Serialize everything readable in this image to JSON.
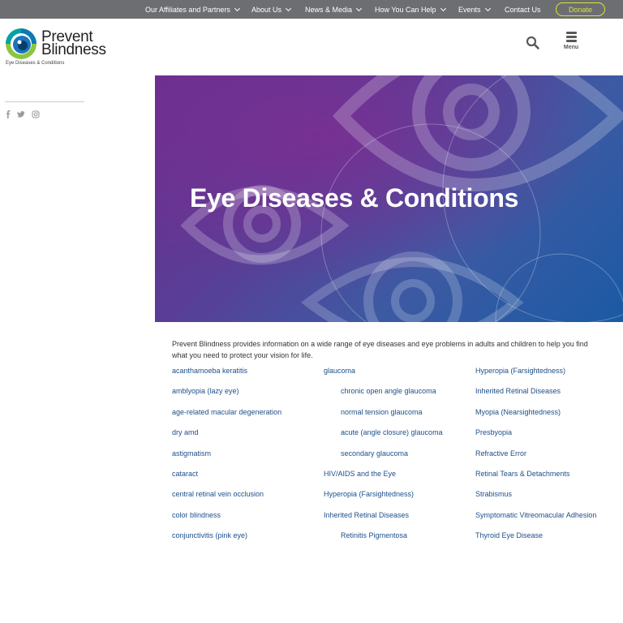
{
  "topnav": {
    "items": [
      {
        "label": "Our Affiliates and Partners",
        "has_dropdown": true
      },
      {
        "label": "About Us",
        "has_dropdown": true
      },
      {
        "label": "News & Media",
        "has_dropdown": true
      },
      {
        "label": "How You Can Help",
        "has_dropdown": true
      },
      {
        "label": "Events",
        "has_dropdown": true
      },
      {
        "label": "Contact Us",
        "has_dropdown": false
      }
    ],
    "donate_label": "Donate"
  },
  "header": {
    "logo_line1": "Prevent",
    "logo_line2": "Blindness",
    "logo_subtitle": "Eye Diseases & Conditions",
    "search_icon": "search-icon",
    "menu_label": "Menu"
  },
  "sidebar": {
    "social": [
      "facebook-icon",
      "twitter-icon",
      "instagram-icon"
    ]
  },
  "hero": {
    "title": "Eye Diseases & Conditions"
  },
  "intro": "Prevent Blindness provides information on a wide range of eye diseases and eye problems in adults and children to help you find what you need to protect your vision for life.",
  "links": {
    "col1": [
      "acanthamoeba keratitis",
      "amblyopia (lazy eye)",
      "age-related macular degeneration",
      "dry amd",
      "astigmatism",
      "cataract",
      "central retinal vein occlusion",
      "color blindness",
      "conjunctivitis (pink eye)"
    ],
    "col2": [
      {
        "label": "glaucoma",
        "indent": false
      },
      {
        "label": "chronic open angle glaucoma",
        "indent": true
      },
      {
        "label": "normal tension glaucoma",
        "indent": true
      },
      {
        "label": "acute (angle closure) glaucoma",
        "indent": true
      },
      {
        "label": "secondary glaucoma",
        "indent": true
      },
      {
        "label": "HIV/AIDS and the Eye",
        "indent": false
      },
      {
        "label": "Hyperopia (Farsightedness)",
        "indent": false
      },
      {
        "label": "Inherited Retinal Diseases",
        "indent": false
      },
      {
        "label": "Retinitis Pigmentosa",
        "indent": true
      }
    ],
    "col3": [
      "Hyperopia (Farsightedness)",
      "Inherited Retinal Diseases",
      "Myopia (Nearsightedness)",
      "Presbyopia",
      "Refractive Error",
      "Retinal Tears & Detachments",
      "Strabismus",
      "Symptomatic Vitreomacular Adhesion",
      "Thyroid Eye Disease"
    ]
  },
  "colors": {
    "topbar": "#6d6e71",
    "donate": "#d7e33c",
    "link": "#1c4f8a",
    "hero_start": "#6a2e8f",
    "hero_end": "#1b5aa4"
  }
}
